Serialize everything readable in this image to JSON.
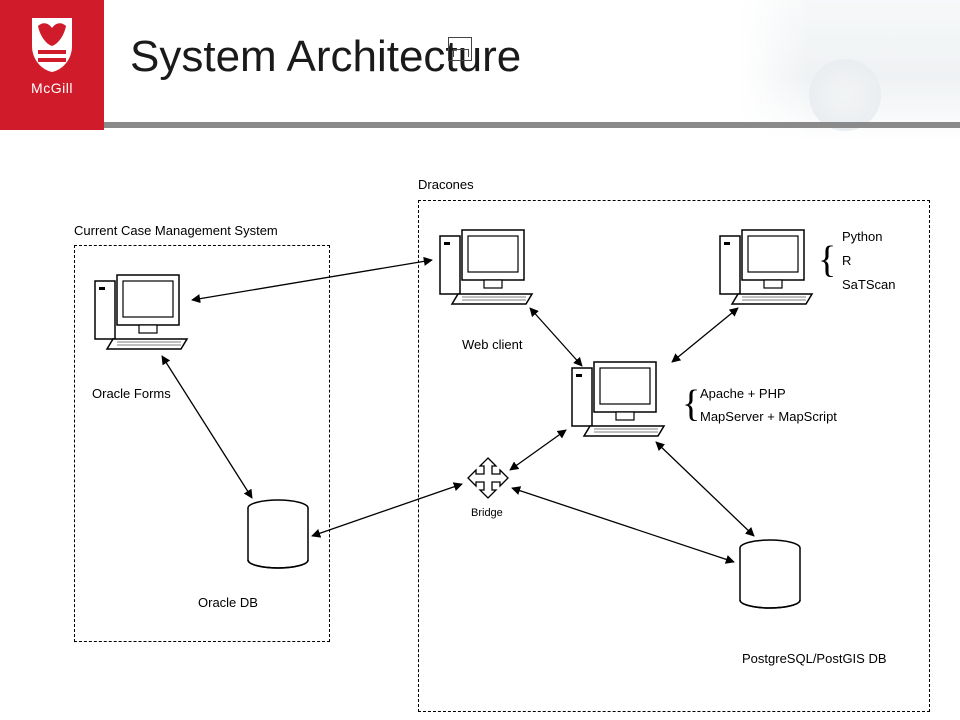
{
  "header": {
    "logo_text": "McGill",
    "title": "System Architecture"
  },
  "groups": {
    "left_label": "Current Case Management System",
    "right_label": "Dracones"
  },
  "nodes": {
    "oracle_forms": "Oracle Forms",
    "oracle_db": "Oracle DB",
    "web_client": "Web client",
    "bridge": "Bridge",
    "postgis": "PostgreSQL/PostGIS DB",
    "mid_server": {
      "line1": "Apache + PHP",
      "line2": "MapServer + MapScript"
    },
    "analytics": {
      "line1": "Python",
      "line2": "R",
      "line3": "SaTScan"
    }
  },
  "braces": {
    "glyph": "{"
  }
}
